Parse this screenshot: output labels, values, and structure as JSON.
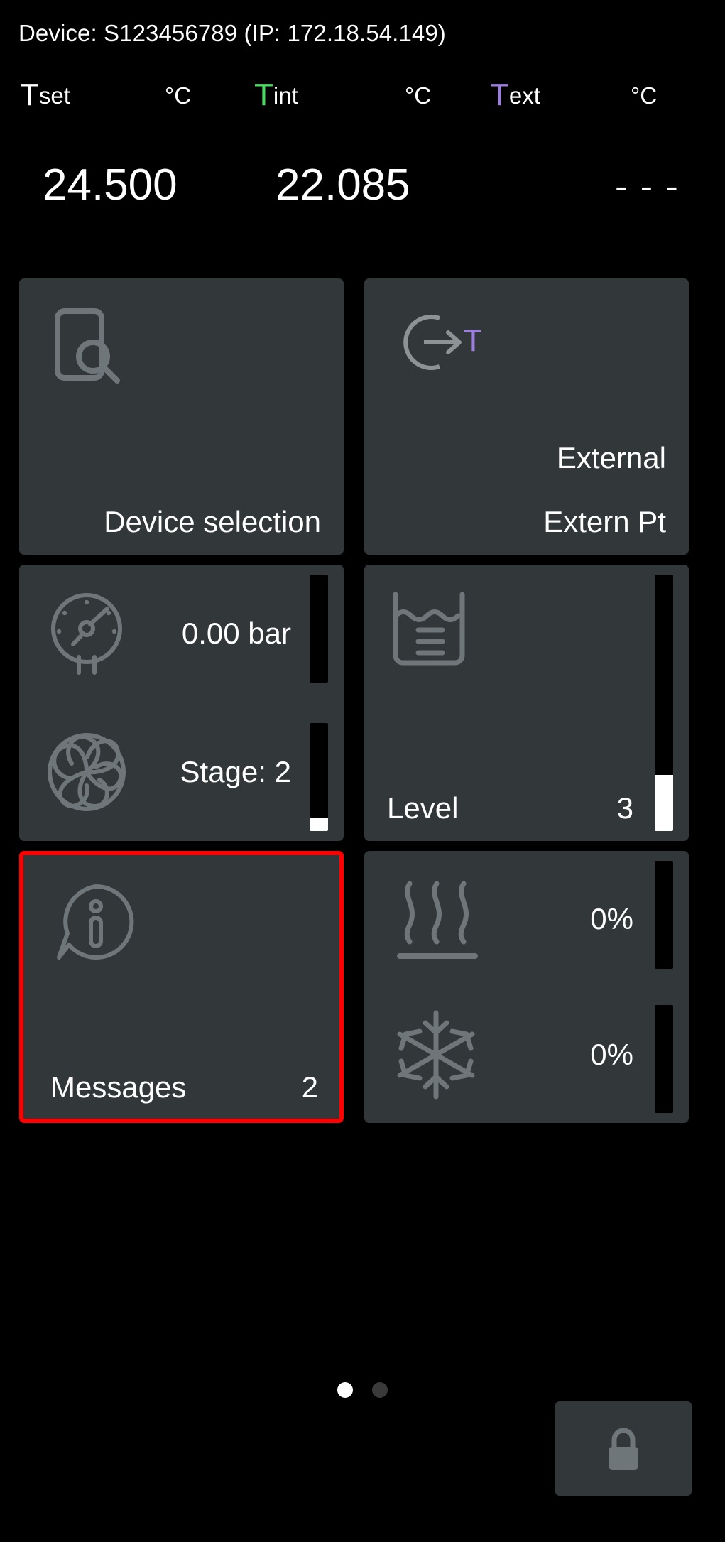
{
  "header": {
    "device_line": "Device: S123456789 (IP: 172.18.54.149)",
    "temperatures": [
      {
        "symbol": "T",
        "subscript": "set",
        "unit": "°C",
        "value": "24.500",
        "color": "#ffffff"
      },
      {
        "symbol": "T",
        "subscript": "int",
        "unit": "°C",
        "value": "22.085",
        "color": "#4cd964"
      },
      {
        "symbol": "T",
        "subscript": "ext",
        "unit": "°C",
        "value": "- - -",
        "color": "#9b7ede"
      }
    ]
  },
  "tiles": {
    "device_selection": {
      "icon": "device-search-icon",
      "label": "Device selection"
    },
    "external": {
      "icon": "external-source-icon",
      "label_primary": "External",
      "label_secondary": "Extern Pt"
    },
    "pressure_stage": {
      "pressure": {
        "icon": "pressure-gauge-icon",
        "value": "0.00 bar",
        "bar_percent": 0
      },
      "stage": {
        "icon": "pump-impeller-icon",
        "value": "Stage: 2",
        "bar_percent": 12
      }
    },
    "level": {
      "icon": "fill-level-icon",
      "label": "Level",
      "value": "3",
      "bar_percent": 22
    },
    "messages": {
      "icon": "message-info-icon",
      "label": "Messages",
      "count": "2",
      "alert_color": "#ff0000"
    },
    "heat_cool": {
      "heating": {
        "icon": "heating-icon",
        "value": "0%",
        "bar_percent": 0
      },
      "cooling": {
        "icon": "cooling-snowflake-icon",
        "value": "0%",
        "bar_percent": 0
      }
    }
  },
  "footer": {
    "pagination": {
      "total": 2,
      "active_index": 0
    },
    "lock_button": {
      "icon": "lock-icon"
    }
  },
  "colors": {
    "background": "#000000",
    "tile": "#32373a",
    "icon": "#6f7679",
    "text": "#ffffff",
    "accent_green": "#4cd964",
    "accent_purple": "#9b7ede",
    "alert_red": "#ff0000"
  }
}
